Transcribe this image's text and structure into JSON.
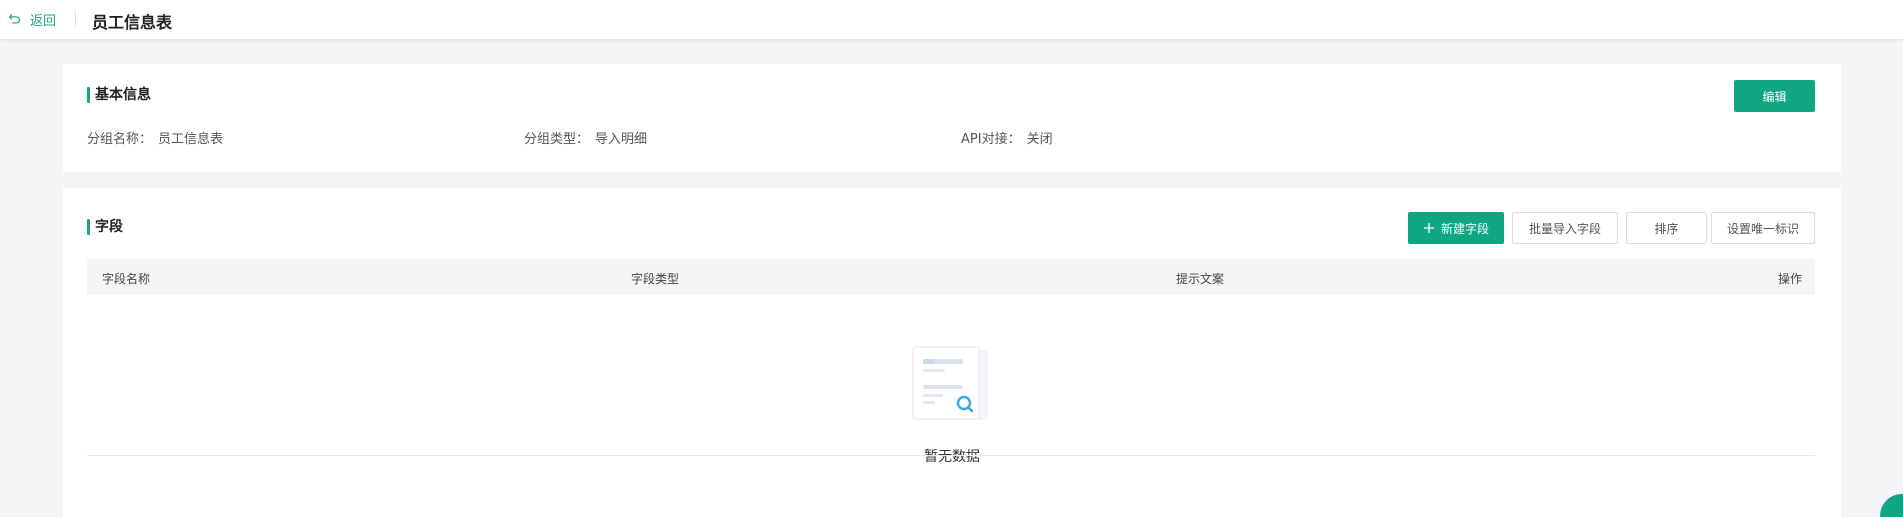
{
  "header": {
    "back_label": "返回",
    "title": "员工信息表"
  },
  "basic_info": {
    "section_title": "基本信息",
    "edit_label": "编辑",
    "fields": [
      {
        "label": "分组名称：",
        "value": "员工信息表"
      },
      {
        "label": "分组类型：",
        "value": "导入明细"
      },
      {
        "label": "API对接：",
        "value": "关闭"
      }
    ]
  },
  "fields_section": {
    "section_title": "字段",
    "buttons": {
      "new_field": "新建字段",
      "batch_import": "批量导入字段",
      "sort": "排序",
      "unique_key": "设置唯一标识"
    },
    "table": {
      "columns": [
        "字段名称",
        "字段类型",
        "提示文案",
        "操作"
      ],
      "rows": [],
      "empty_text": "暂无数据"
    }
  },
  "colors": {
    "accent": "#11a683",
    "page_bg": "#f4f5f7"
  }
}
